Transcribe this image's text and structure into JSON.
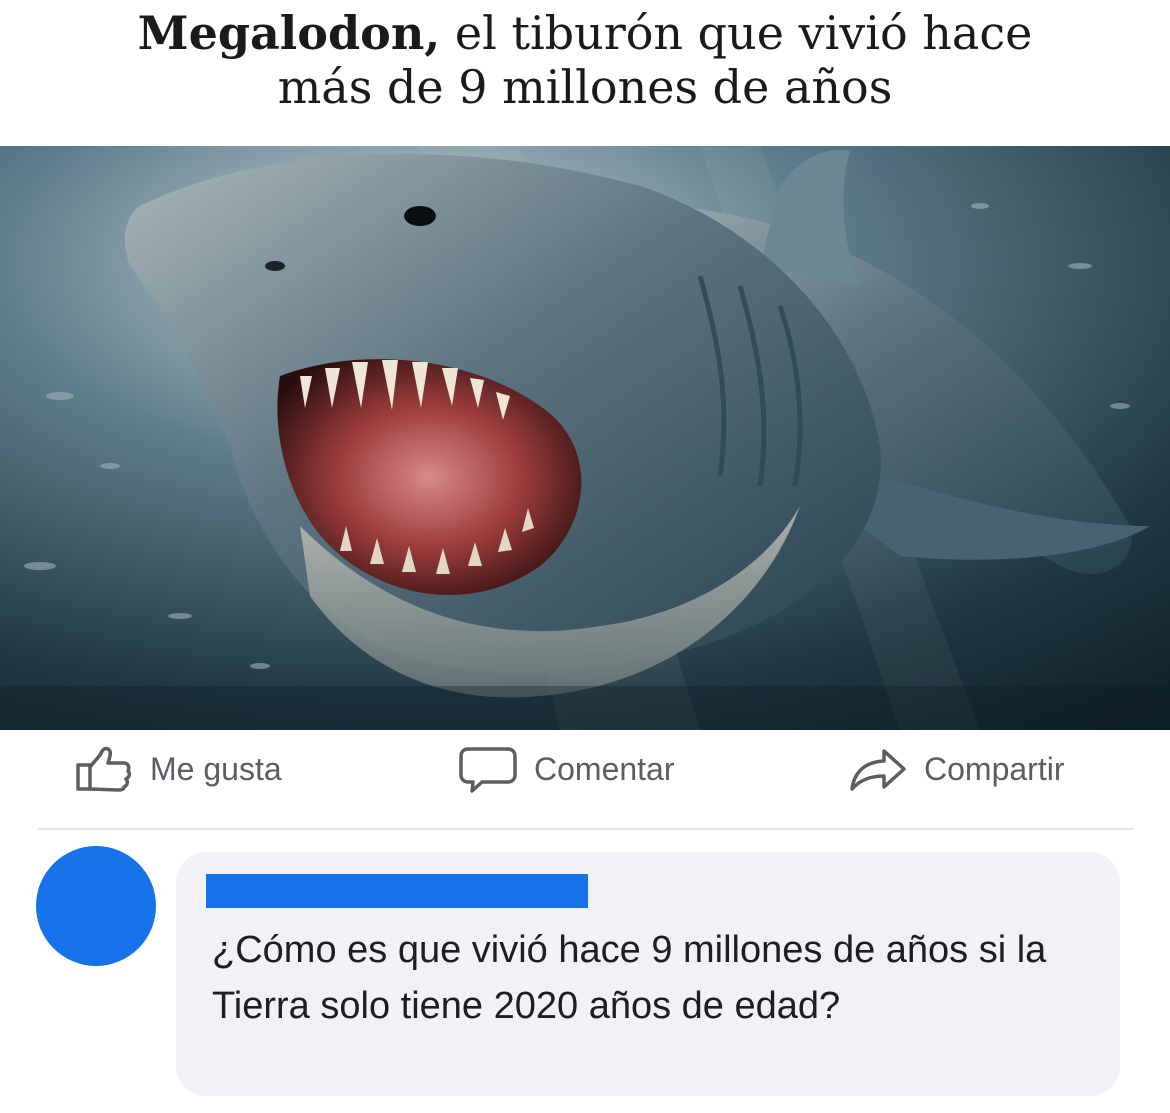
{
  "headline": {
    "bold_part": "Megalodon,",
    "rest_line1": " el tiburón que vivió hace",
    "line2": "más de 9 millones de años"
  },
  "image": {
    "subject": "megalodon shark illustration underwater"
  },
  "actions": [
    {
      "label": "Me gusta",
      "icon": "like-thumb-icon"
    },
    {
      "label": "Comentar",
      "icon": "comment-bubble-icon"
    },
    {
      "label": "Compartir",
      "icon": "share-arrow-icon"
    }
  ],
  "comment": {
    "author": "",
    "text": "¿Cómo es que vivió hace 9 millones de años si la Tierra solo tiene 2020 años de edad?"
  },
  "colors": {
    "accent_blue": "#1673ea",
    "action_gray": "#5a5d62",
    "bubble_bg": "#f0f2f5"
  }
}
